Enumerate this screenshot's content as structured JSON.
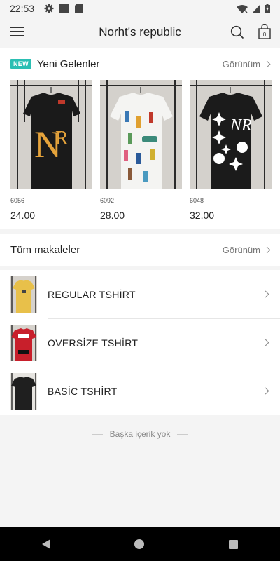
{
  "status_bar": {
    "time": "22:53",
    "icons": [
      "gear-icon",
      "square-icon",
      "sd-card-icon",
      "wifi-off-icon",
      "signal-icon",
      "battery-icon"
    ]
  },
  "header": {
    "title": "Norht's republic",
    "cart_count": "0"
  },
  "new_arrivals": {
    "badge": "NEW",
    "title": "Yeni Gelenler",
    "view_all": "Görünüm",
    "products": [
      {
        "code": "6056",
        "price": "24.00",
        "shirt": "black-nr-gold"
      },
      {
        "code": "6092",
        "price": "28.00",
        "shirt": "white-printed"
      },
      {
        "code": "6048",
        "price": "32.00",
        "shirt": "black-nr-white"
      }
    ]
  },
  "all_articles": {
    "title": "Tüm makaleler",
    "view_all": "Görünüm"
  },
  "categories": [
    {
      "label": "REGULAR TSHİRT",
      "thumb_color": "#e8c04a"
    },
    {
      "label": "OVERSİZE TSHİRT",
      "thumb_color": "#c81f2b"
    },
    {
      "label": "BASİC TSHİRT",
      "thumb_color": "#1f1f1f"
    }
  ],
  "footer_note": "Başka içerik yok",
  "colors": {
    "accent": "#2bbfb3",
    "background": "#f4f4f4",
    "navbar": "#000000"
  }
}
